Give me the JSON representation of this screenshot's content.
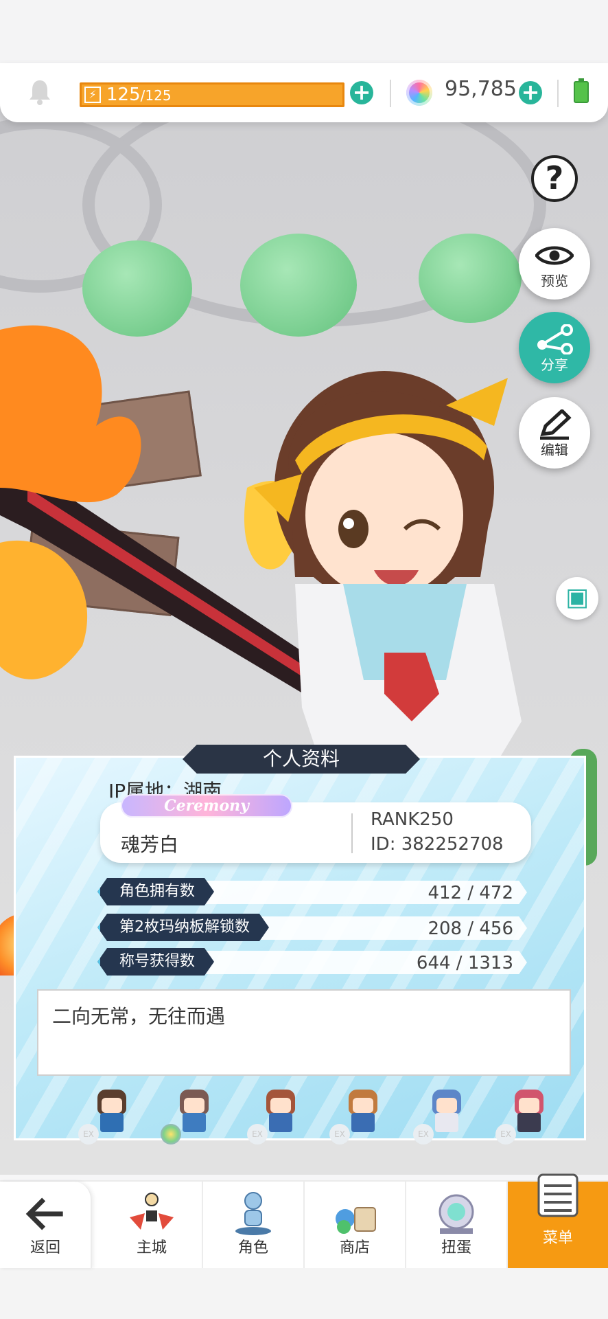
{
  "topbar": {
    "stamina_current": "125",
    "stamina_max": "/125",
    "stamina_fraction": 1.0,
    "gems": "95,785",
    "icons": [
      "bell-icon",
      "bolt-icon",
      "plus-icon",
      "gem-icon",
      "battery-icon"
    ]
  },
  "side_buttons": {
    "help": "?",
    "preview": "预览",
    "share": "分享",
    "edit": "编辑"
  },
  "profile": {
    "title": "个人资料",
    "ip_location": "IP属地：湖南",
    "badge": "Ceremony",
    "name": "魂芳白",
    "rank": "RANK250",
    "id": "ID: 382252708",
    "stats": [
      {
        "label": "角色拥有数",
        "value": "412 / 472"
      },
      {
        "label": "第2枚玛纳板解锁数",
        "value": "208 / 456"
      },
      {
        "label": "称号获得数",
        "value": "644 / 1313"
      }
    ],
    "bio": "二向无常，无往而遇"
  },
  "sprites": [
    {
      "badge": "EX"
    },
    {
      "badge": ""
    },
    {
      "badge": "EX"
    },
    {
      "badge": "EX"
    },
    {
      "badge": "EX"
    },
    {
      "badge": "EX"
    }
  ],
  "nav": {
    "back": "返回",
    "town": "主城",
    "characters": "角色",
    "shop": "商店",
    "gacha": "扭蛋",
    "menu": "菜单"
  },
  "colors": {
    "accent_orange": "#f69a12",
    "accent_teal": "#2fb8a6",
    "stat_label_bg": "#25364f"
  }
}
